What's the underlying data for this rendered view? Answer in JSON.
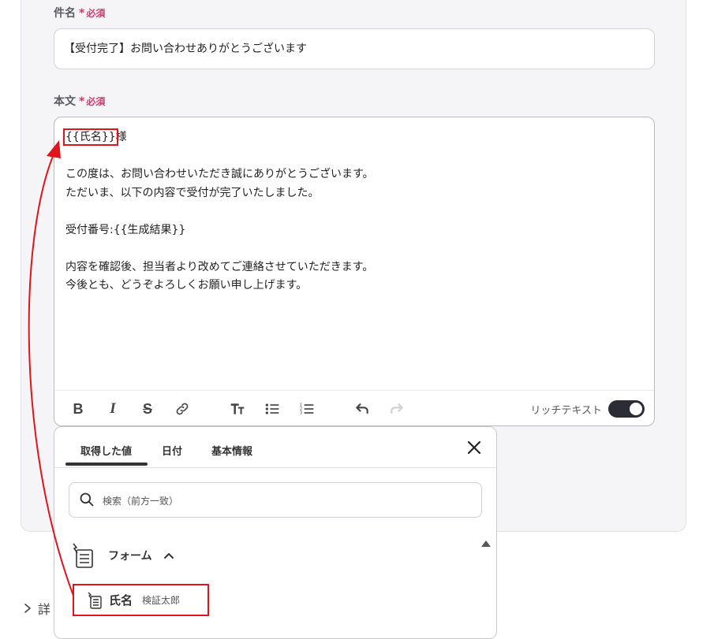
{
  "subject": {
    "label": "件名",
    "required": "必須",
    "value": "【受付完了】お問い合わせありがとうございます"
  },
  "body": {
    "label": "本文",
    "required": "必須",
    "var_name": "{{氏名}}",
    "greeting_suffix": "様",
    "lines": [
      "",
      "この度は、お問い合わせいただき誠にありがとうございます。",
      "ただいま、以下の内容で受付が完了いたしました。",
      "",
      "受付番号:{{生成結果}}",
      "",
      "内容を確認後、担当者より改めてご連絡させていただきます。",
      "今後とも、どうぞよろしくお願い申し上げます。"
    ]
  },
  "toolbar": {
    "rich_text_label": "リッチテキスト",
    "rich_text_on": true
  },
  "picker": {
    "tabs": [
      "取得した値",
      "日付",
      "基本情報"
    ],
    "active_tab": 0,
    "search_placeholder": "検索（前方一致）",
    "group_label": "フォーム",
    "item": {
      "name": "氏名",
      "value": "検証太郎"
    }
  },
  "details_label": "詳",
  "colors": {
    "accent_red": "#e0141c",
    "required": "#d9356c",
    "toggle": "#2c2c34"
  }
}
